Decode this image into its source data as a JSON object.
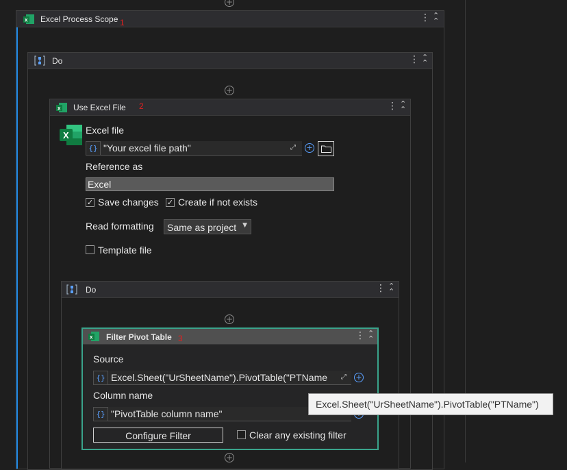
{
  "top_add": "+",
  "scope": {
    "title": "Excel Process Scope",
    "number": "1"
  },
  "do_outer": {
    "title": "Do"
  },
  "use_excel": {
    "title": "Use Excel File",
    "number": "2",
    "excel_file_label": "Excel file",
    "excel_file_value": "\"Your excel file path\"",
    "reference_label": "Reference as",
    "reference_value": "Excel",
    "save_changes_label": "Save changes",
    "create_if_not_exists_label": "Create if not exists",
    "read_formatting_label": "Read formatting",
    "read_formatting_value": "Same as project",
    "template_file_label": "Template file"
  },
  "do_inner": {
    "title": "Do"
  },
  "filter_pivot": {
    "title": "Filter Pivot Table",
    "number": "3",
    "source_label": "Source",
    "source_value": "Excel.Sheet(\"UrSheetName\").PivotTable(\"PTName",
    "column_name_label": "Column name",
    "column_name_value": "\"PivotTable column name\"",
    "configure_filter_label": "Configure Filter",
    "clear_filter_label": "Clear any existing filter"
  },
  "tooltip": {
    "text": "Excel.Sheet(\"UrSheetName\").PivotTable(\"PTName\")"
  },
  "icons": {
    "excel": "excel-icon",
    "sequence": "sequence-icon",
    "kebab": "kebab-icon",
    "collapse": "collapse-icon",
    "add": "add-icon",
    "folder": "folder-icon",
    "expand": "expand-icon"
  },
  "colors": {
    "accent_blue": "#1e88e5",
    "excel_green": "#21a366",
    "selected_border": "#3aa48c",
    "number_red": "#e02020"
  }
}
